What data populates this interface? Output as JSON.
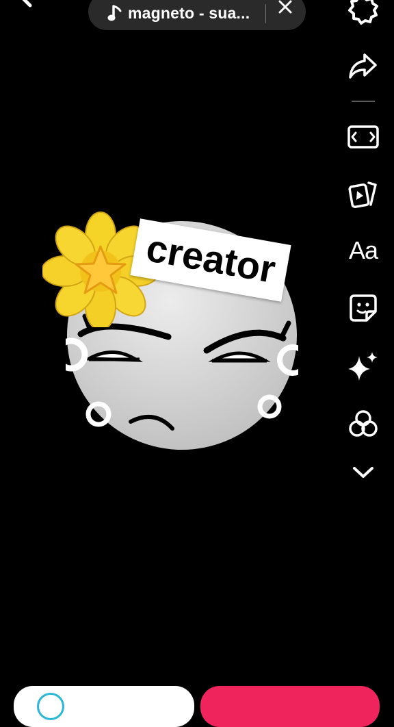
{
  "top_bar": {
    "back_icon": "arrow-left-icon",
    "sound_title": "magneto - sua...",
    "close_icon": "close-icon"
  },
  "toolbar": {
    "items": [
      {
        "name": "settings",
        "icon": "gear-icon"
      },
      {
        "name": "share",
        "icon": "share-arrow-icon"
      },
      {
        "name": "resize",
        "icon": "aspect-ratio-icon"
      },
      {
        "name": "templates",
        "icon": "cards-play-icon"
      },
      {
        "name": "text",
        "label": "Aa"
      },
      {
        "name": "stickers",
        "icon": "sticker-icon"
      },
      {
        "name": "effects",
        "icon": "sparkle-icon"
      },
      {
        "name": "filters",
        "icon": "filters-circles-icon"
      },
      {
        "name": "more",
        "icon": "chevron-down-icon"
      }
    ]
  },
  "canvas": {
    "sticker_text": "creator",
    "emoji": "star-flower"
  },
  "colors": {
    "background": "#000000",
    "accent": "#f0245d",
    "pill": "#2a2a2a"
  }
}
